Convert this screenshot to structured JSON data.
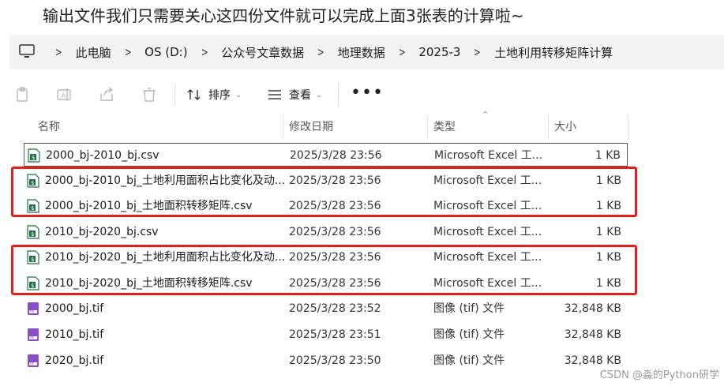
{
  "caption": "输出文件我们只需要关心这四份文件就可以完成上面3张表的计算啦~",
  "breadcrumb": [
    "此电脑",
    "OS (D:)",
    "公众号文章数据",
    "地理数据",
    "2025-3",
    "土地利用转移矩阵计算"
  ],
  "toolbar": {
    "sort_label": "排序",
    "view_label": "查看",
    "more_label": "•••"
  },
  "columns": {
    "name": "名称",
    "modified": "修改日期",
    "type": "类型",
    "size": "大小"
  },
  "files": [
    {
      "name": "2000_bj-2010_bj.csv",
      "date": "2025/3/28 23:56",
      "type": "Microsoft Excel 工...",
      "size": "1 KB",
      "icon": "csv-file-icon"
    },
    {
      "name": "2000_bj-2010_bj_土地利用面积占比变化及动...",
      "date": "2025/3/28 23:56",
      "type": "Microsoft Excel 工...",
      "size": "1 KB",
      "icon": "csv-file-icon"
    },
    {
      "name": "2000_bj-2010_bj_土地面积转移矩阵.csv",
      "date": "2025/3/28 23:56",
      "type": "Microsoft Excel 工...",
      "size": "1 KB",
      "icon": "csv-file-icon"
    },
    {
      "name": "2010_bj-2020_bj.csv",
      "date": "2025/3/28 23:56",
      "type": "Microsoft Excel 工...",
      "size": "1 KB",
      "icon": "csv-file-icon"
    },
    {
      "name": "2010_bj-2020_bj_土地利用面积占比变化及动...",
      "date": "2025/3/28 23:56",
      "type": "Microsoft Excel 工...",
      "size": "1 KB",
      "icon": "csv-file-icon"
    },
    {
      "name": "2010_bj-2020_bj_土地面积转移矩阵.csv",
      "date": "2025/3/28 23:56",
      "type": "Microsoft Excel 工...",
      "size": "1 KB",
      "icon": "csv-file-icon"
    },
    {
      "name": "2000_bj.tif",
      "date": "2025/3/28 23:52",
      "type": "图像 (tif) 文件",
      "size": "32,848 KB",
      "icon": "tif-file-icon"
    },
    {
      "name": "2010_bj.tif",
      "date": "2025/3/28 23:51",
      "type": "图像 (tif) 文件",
      "size": "32,848 KB",
      "icon": "tif-file-icon"
    },
    {
      "name": "2020_bj.tif",
      "date": "2025/3/28 23:50",
      "type": "图像 (tif) 文件",
      "size": "32,848 KB",
      "icon": "tif-file-icon"
    }
  ],
  "watermark": "CSDN @淼的Python研学",
  "colors": {
    "highlight_box": "#e0201b",
    "csv_icon": "#1e7145",
    "tif_icon": "#8a4fc4",
    "address_bar_bg": "#f3f3f3"
  }
}
